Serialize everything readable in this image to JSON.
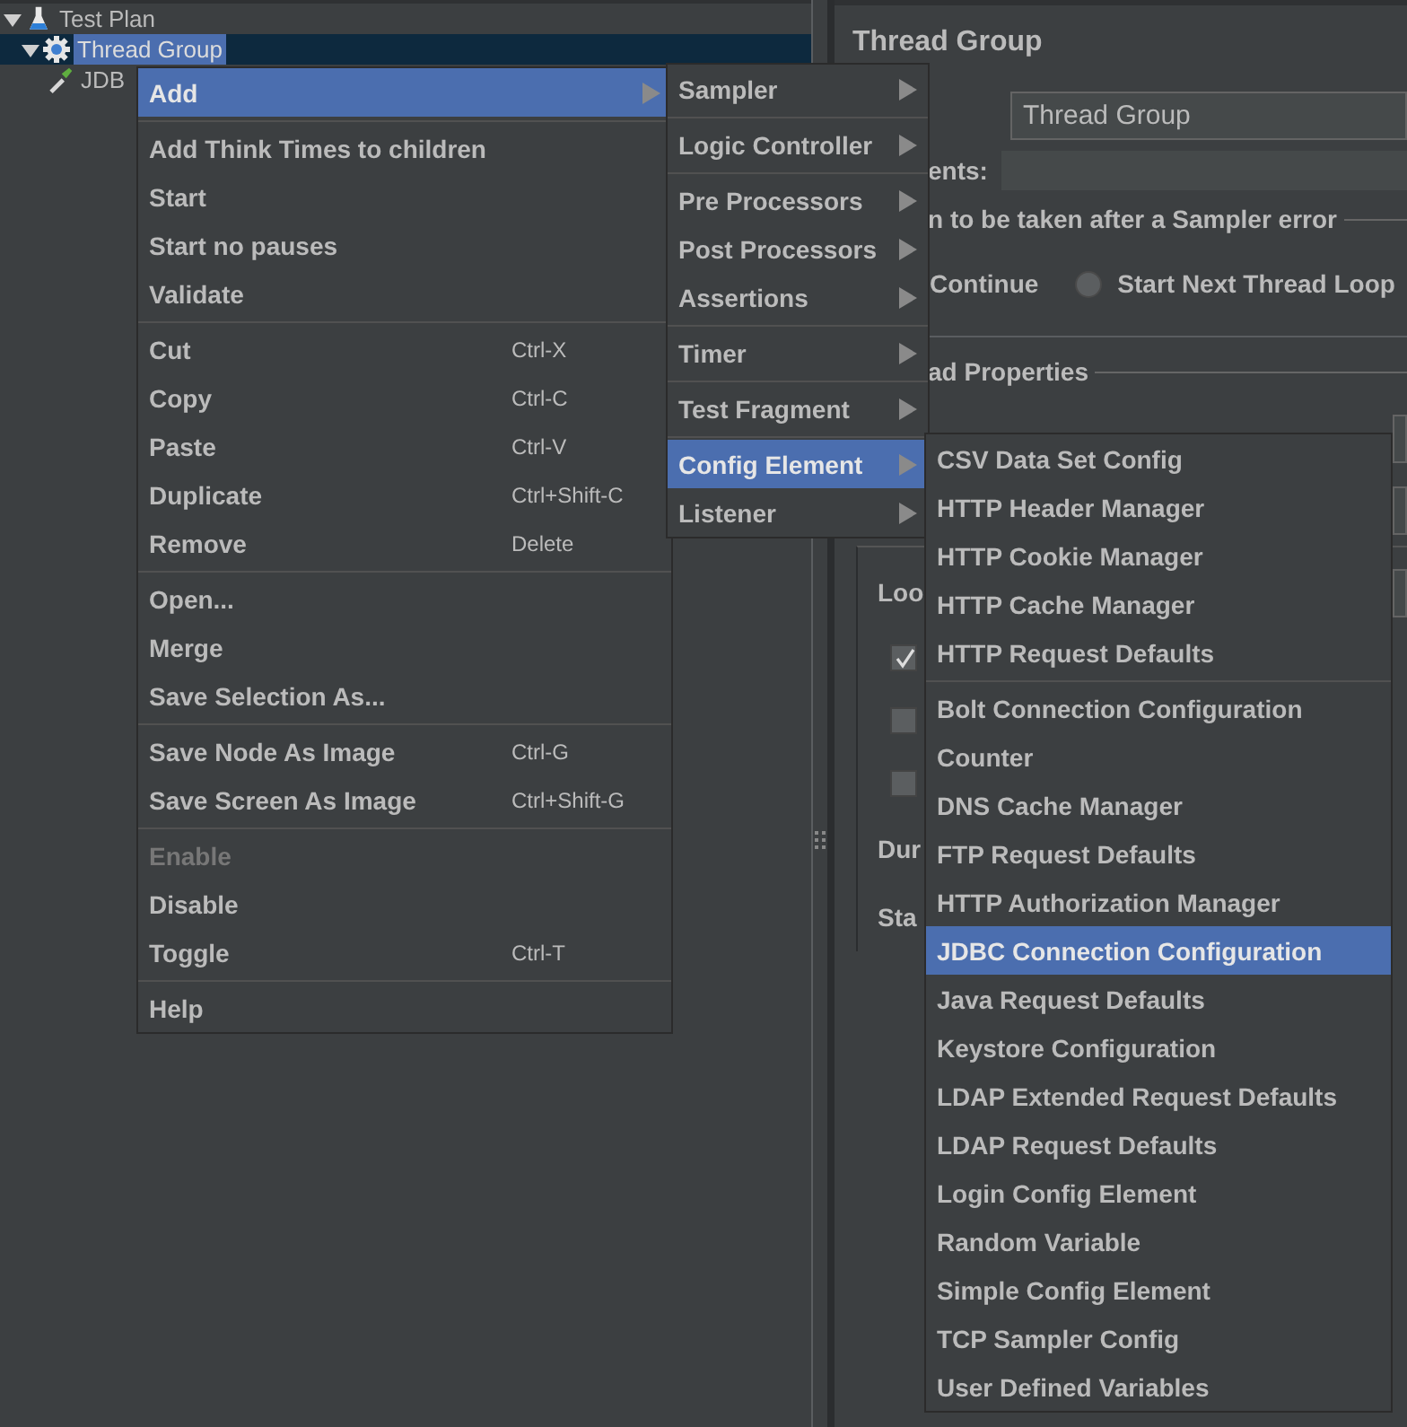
{
  "tree": [
    {
      "label": "Test Plan",
      "kind": "plan",
      "selected": false,
      "expanded": true,
      "children": [
        {
          "label": "Thread Group",
          "kind": "group",
          "selected": true,
          "expanded": true,
          "children": [
            {
              "label": "JDB",
              "kind": "config",
              "selected": false
            }
          ]
        }
      ]
    }
  ],
  "panel": {
    "title": "Thread Group",
    "name_value": "Thread Group",
    "comments_label": "ents:",
    "error_action_label": "n to be taken after a Sampler error",
    "continue_label": "Continue",
    "next_loop_option": {
      "label": "Start Next Thread Loop",
      "selected": false
    },
    "properties_label": "ad Properties",
    "loop_label": "Loo",
    "checkboxes": [
      {
        "checked": true
      },
      {
        "checked": false
      },
      {
        "checked": false
      }
    ],
    "duration_label": "Dur",
    "startup_label": "Sta"
  },
  "context_menu": [
    {
      "kind": "item",
      "label": "Add",
      "selected": true,
      "disabled": false,
      "submenu": true
    },
    {
      "kind": "separator"
    },
    {
      "kind": "item",
      "label": "Add Think Times to children",
      "selected": false,
      "disabled": false,
      "submenu": false
    },
    {
      "kind": "item",
      "label": "Start",
      "selected": false,
      "disabled": false,
      "submenu": false
    },
    {
      "kind": "item",
      "label": "Start no pauses",
      "selected": false,
      "disabled": false,
      "submenu": false
    },
    {
      "kind": "item",
      "label": "Validate",
      "selected": false,
      "disabled": false,
      "submenu": false
    },
    {
      "kind": "separator"
    },
    {
      "kind": "item",
      "label": "Cut",
      "shortcut": "Ctrl-X",
      "selected": false,
      "disabled": false,
      "submenu": false
    },
    {
      "kind": "item",
      "label": "Copy",
      "shortcut": "Ctrl-C",
      "selected": false,
      "disabled": false,
      "submenu": false
    },
    {
      "kind": "item",
      "label": "Paste",
      "shortcut": "Ctrl-V",
      "selected": false,
      "disabled": false,
      "submenu": false
    },
    {
      "kind": "item",
      "label": "Duplicate",
      "shortcut": "Ctrl+Shift-C",
      "selected": false,
      "disabled": false,
      "submenu": false
    },
    {
      "kind": "item",
      "label": "Remove",
      "shortcut": "Delete",
      "selected": false,
      "disabled": false,
      "submenu": false
    },
    {
      "kind": "separator"
    },
    {
      "kind": "item",
      "label": "Open...",
      "selected": false,
      "disabled": false,
      "submenu": false
    },
    {
      "kind": "item",
      "label": "Merge",
      "selected": false,
      "disabled": false,
      "submenu": false
    },
    {
      "kind": "item",
      "label": "Save Selection As...",
      "selected": false,
      "disabled": false,
      "submenu": false
    },
    {
      "kind": "separator"
    },
    {
      "kind": "item",
      "label": "Save Node As Image",
      "shortcut": "Ctrl-G",
      "selected": false,
      "disabled": false,
      "submenu": false
    },
    {
      "kind": "item",
      "label": "Save Screen As Image",
      "shortcut": "Ctrl+Shift-G",
      "selected": false,
      "disabled": false,
      "submenu": false
    },
    {
      "kind": "separator"
    },
    {
      "kind": "item",
      "label": "Enable",
      "selected": false,
      "disabled": true,
      "submenu": false
    },
    {
      "kind": "item",
      "label": "Disable",
      "selected": false,
      "disabled": false,
      "submenu": false
    },
    {
      "kind": "item",
      "label": "Toggle",
      "shortcut": "Ctrl-T",
      "selected": false,
      "disabled": false,
      "submenu": false
    },
    {
      "kind": "separator"
    },
    {
      "kind": "item",
      "label": "Help",
      "selected": false,
      "disabled": false,
      "submenu": false
    }
  ],
  "add_submenu": [
    {
      "kind": "item",
      "label": "Sampler",
      "selected": false,
      "submenu": true
    },
    {
      "kind": "separator"
    },
    {
      "kind": "item",
      "label": "Logic Controller",
      "selected": false,
      "submenu": true
    },
    {
      "kind": "separator"
    },
    {
      "kind": "item",
      "label": "Pre Processors",
      "selected": false,
      "submenu": true
    },
    {
      "kind": "item",
      "label": "Post Processors",
      "selected": false,
      "submenu": true
    },
    {
      "kind": "item",
      "label": "Assertions",
      "selected": false,
      "submenu": true
    },
    {
      "kind": "separator"
    },
    {
      "kind": "item",
      "label": "Timer",
      "selected": false,
      "submenu": true
    },
    {
      "kind": "separator"
    },
    {
      "kind": "item",
      "label": "Test Fragment",
      "selected": false,
      "submenu": true
    },
    {
      "kind": "separator"
    },
    {
      "kind": "item",
      "label": "Config Element",
      "selected": true,
      "submenu": true
    },
    {
      "kind": "item",
      "label": "Listener",
      "selected": false,
      "submenu": true
    }
  ],
  "config_submenu": [
    {
      "kind": "item",
      "label": "CSV Data Set Config",
      "selected": false
    },
    {
      "kind": "item",
      "label": "HTTP Header Manager",
      "selected": false
    },
    {
      "kind": "item",
      "label": "HTTP Cookie Manager",
      "selected": false
    },
    {
      "kind": "item",
      "label": "HTTP Cache Manager",
      "selected": false
    },
    {
      "kind": "item",
      "label": "HTTP Request Defaults",
      "selected": false
    },
    {
      "kind": "separator"
    },
    {
      "kind": "item",
      "label": "Bolt Connection Configuration",
      "selected": false
    },
    {
      "kind": "item",
      "label": "Counter",
      "selected": false
    },
    {
      "kind": "item",
      "label": "DNS Cache Manager",
      "selected": false
    },
    {
      "kind": "item",
      "label": "FTP Request Defaults",
      "selected": false
    },
    {
      "kind": "item",
      "label": "HTTP Authorization Manager",
      "selected": false
    },
    {
      "kind": "item",
      "label": "JDBC Connection Configuration",
      "selected": true
    },
    {
      "kind": "item",
      "label": "Java Request Defaults",
      "selected": false
    },
    {
      "kind": "item",
      "label": "Keystore Configuration",
      "selected": false
    },
    {
      "kind": "item",
      "label": "LDAP Extended Request Defaults",
      "selected": false
    },
    {
      "kind": "item",
      "label": "LDAP Request Defaults",
      "selected": false
    },
    {
      "kind": "item",
      "label": "Login Config Element",
      "selected": false
    },
    {
      "kind": "item",
      "label": "Random Variable",
      "selected": false
    },
    {
      "kind": "item",
      "label": "Simple Config Element",
      "selected": false
    },
    {
      "kind": "item",
      "label": "TCP Sampler Config",
      "selected": false
    },
    {
      "kind": "item",
      "label": "User Defined Variables",
      "selected": false
    }
  ]
}
